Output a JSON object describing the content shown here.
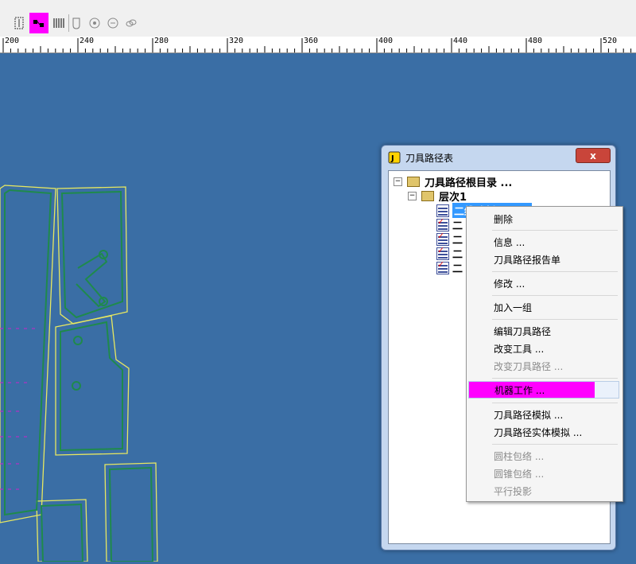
{
  "toolbar": {
    "buttons": [
      "select-icon",
      "snap-icon",
      "comb-icon",
      "cup-icon",
      "gear-icon",
      "gear2-icon",
      "link-icon"
    ],
    "active_index": 1
  },
  "ruler": {
    "labels": [
      "200",
      "240",
      "280",
      "320",
      "360",
      "400",
      "440",
      "480",
      "520"
    ]
  },
  "dialog": {
    "title": "刀具路径表",
    "close_label": "x",
    "tree": {
      "root_label": "刀具路径根目录 ...",
      "layer_label": "层次1",
      "selected_item": "二维雕刻 [000]",
      "items": [
        "二",
        "二",
        "二",
        "二"
      ]
    }
  },
  "context_menu": {
    "items": [
      {
        "label": "删除",
        "disabled": false
      },
      {
        "label": "信息 ...",
        "disabled": false
      },
      {
        "label": "刀具路径报告单",
        "disabled": false
      },
      {
        "label": "修改 ...",
        "disabled": false
      },
      {
        "label": "加入一组",
        "disabled": false
      },
      {
        "label": "编辑刀具路径",
        "disabled": false
      },
      {
        "label": "改变工具 ...",
        "disabled": false
      },
      {
        "label": "改变刀具路径 ...",
        "disabled": true
      },
      {
        "label": "机器工作 ...",
        "disabled": false,
        "highlighted": true
      },
      {
        "label": "刀具路径模拟 ...",
        "disabled": false
      },
      {
        "label": "刀具路径实体模拟 ...",
        "disabled": false
      },
      {
        "label": "圆柱包络 ...",
        "disabled": true
      },
      {
        "label": "圆锥包络 ...",
        "disabled": true
      },
      {
        "label": "平行投影",
        "disabled": true
      }
    ]
  },
  "colors": {
    "canvas": "#3a6ea5",
    "highlight": "#ff00ff",
    "toolpath": "#e8e860",
    "path_green": "#1f8a4c"
  }
}
